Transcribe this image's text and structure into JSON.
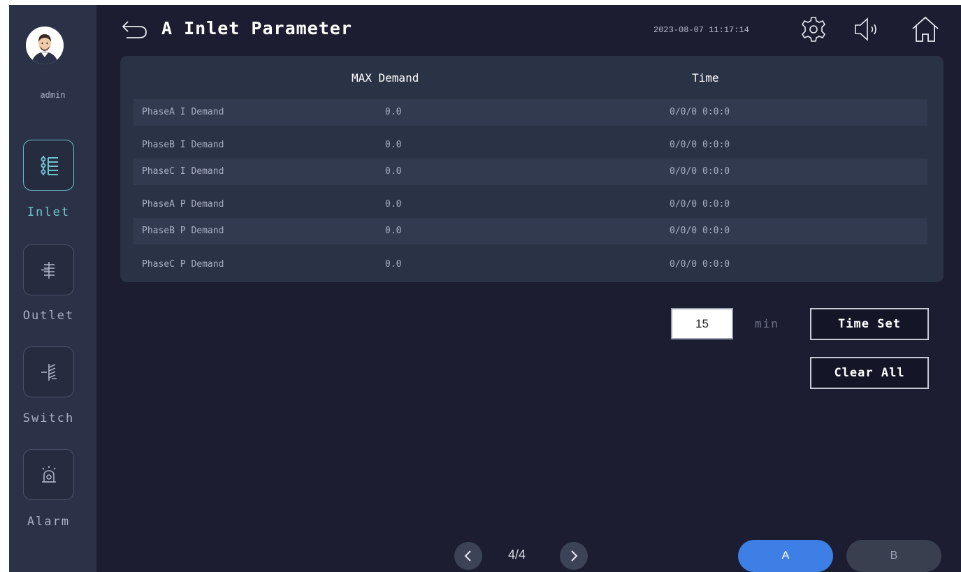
{
  "sidebar": {
    "username": "admin",
    "items": [
      {
        "label": "Inlet",
        "icon": "inlet-icon",
        "active": true
      },
      {
        "label": "Outlet",
        "icon": "outlet-icon",
        "active": false
      },
      {
        "label": "Switch",
        "icon": "switch-icon",
        "active": false
      },
      {
        "label": "Alarm",
        "icon": "alarm-icon",
        "active": false
      }
    ]
  },
  "header": {
    "title": "A Inlet Parameter",
    "datetime": "2023-08-07 11:17:14",
    "icons": [
      "back-arrow-icon",
      "settings-gear-icon",
      "speaker-icon",
      "home-icon"
    ]
  },
  "table": {
    "columns": [
      "",
      "MAX Demand",
      "Time"
    ],
    "rows": [
      {
        "name": "PhaseA I Demand",
        "max_demand": "0.0",
        "time": "0/0/0 0:0:0"
      },
      {
        "name": "PhaseB I Demand",
        "max_demand": "0.0",
        "time": "0/0/0 0:0:0"
      },
      {
        "name": "PhaseC I Demand",
        "max_demand": "0.0",
        "time": "0/0/0 0:0:0"
      },
      {
        "name": "PhaseA P Demand",
        "max_demand": "0.0",
        "time": "0/0/0 0:0:0"
      },
      {
        "name": "PhaseB P Demand",
        "max_demand": "0.0",
        "time": "0/0/0 0:0:0"
      },
      {
        "name": "PhaseC P Demand",
        "max_demand": "0.0",
        "time": "0/0/0 0:0:0"
      }
    ]
  },
  "controls": {
    "interval_value": "15",
    "interval_unit": "min",
    "time_set_label": "Time Set",
    "clear_all_label": "Clear All"
  },
  "footer": {
    "page": "4/4",
    "tabs": [
      {
        "label": "A",
        "active": true
      },
      {
        "label": "B",
        "active": false
      }
    ]
  },
  "colors": {
    "background": "#1c1d30",
    "sidebar": "#2b3247",
    "panel": "#2a3246",
    "accent_teal": "#6fc2cc",
    "active_tab": "#3e7fe6",
    "inactive_tab": "#3a3f50"
  }
}
